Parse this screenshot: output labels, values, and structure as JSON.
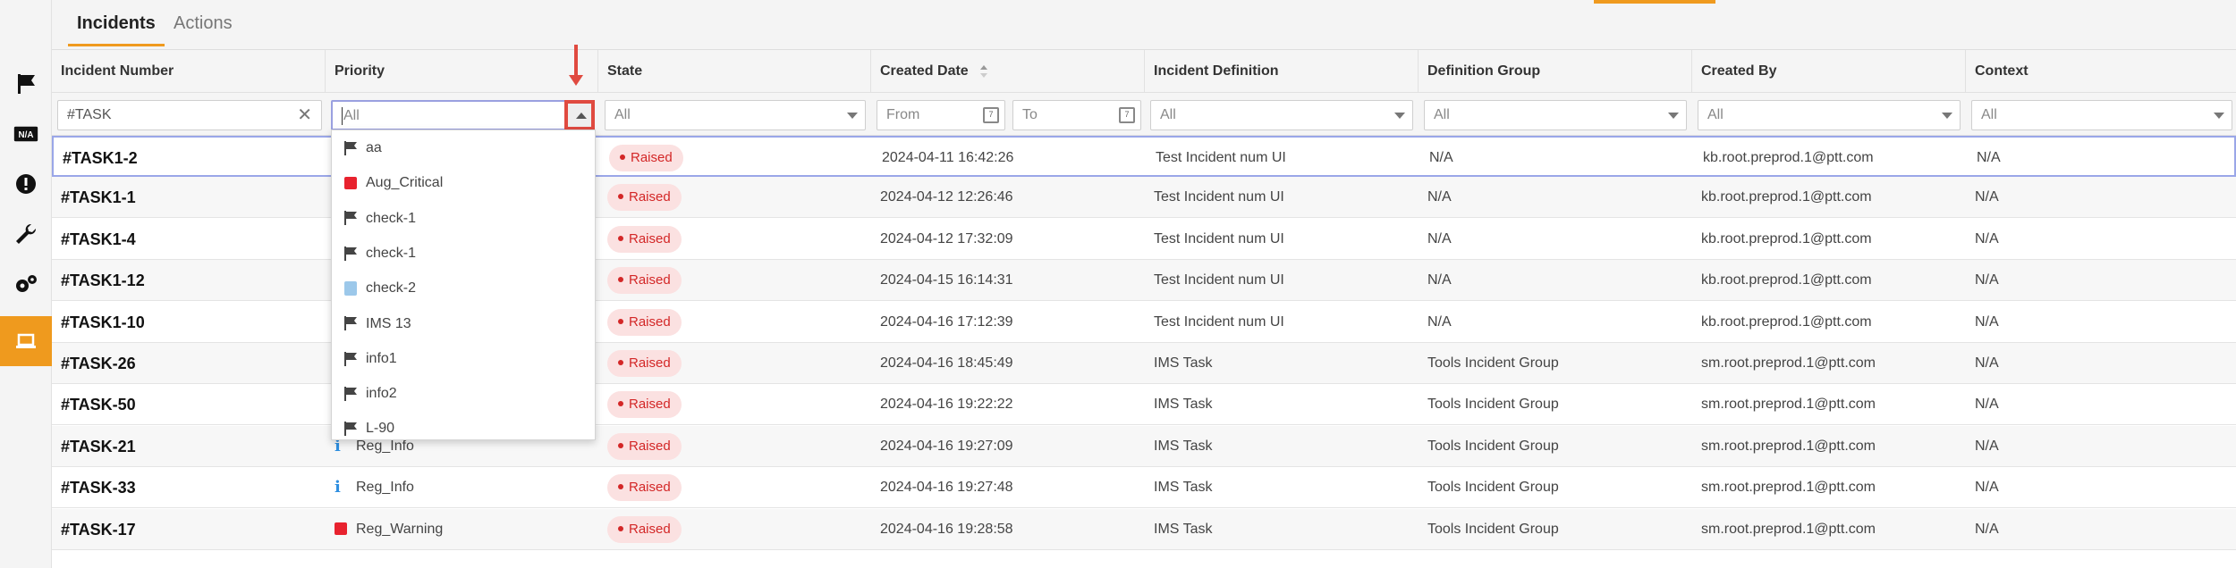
{
  "tabs": [
    "Incidents",
    "Actions"
  ],
  "sidebar": [
    "flag-icon",
    "na-icon",
    "alert-icon",
    "wrench-icon",
    "gears-icon",
    "laptop-icon"
  ],
  "sidebar_na_label": "N/A",
  "columns": [
    "Incident Number",
    "Priority",
    "State",
    "Created Date",
    "Incident Definition",
    "Definition Group",
    "Created By",
    "Context"
  ],
  "filters": {
    "incident_number": "#TASK",
    "priority": "All",
    "state": "All",
    "from": "From",
    "to": "To",
    "incident_definition": "All",
    "definition_group": "All",
    "created_by": "All",
    "context": "All"
  },
  "rows": [
    {
      "num": "#TASK1-2",
      "priority": "",
      "state": "Raised",
      "date": "2024-04-11 16:42:26",
      "definition": "Test Incident num UI",
      "group": "N/A",
      "by": "kb.root.preprod.1@ptt.com",
      "context": "N/A"
    },
    {
      "num": "#TASK1-1",
      "priority": "",
      "state": "Raised",
      "date": "2024-04-12 12:26:46",
      "definition": "Test Incident num UI",
      "group": "N/A",
      "by": "kb.root.preprod.1@ptt.com",
      "context": "N/A"
    },
    {
      "num": "#TASK1-4",
      "priority": "",
      "state": "Raised",
      "date": "2024-04-12 17:32:09",
      "definition": "Test Incident num UI",
      "group": "N/A",
      "by": "kb.root.preprod.1@ptt.com",
      "context": "N/A"
    },
    {
      "num": "#TASK1-12",
      "priority": "",
      "state": "Raised",
      "date": "2024-04-15 16:14:31",
      "definition": "Test Incident num UI",
      "group": "N/A",
      "by": "kb.root.preprod.1@ptt.com",
      "context": "N/A"
    },
    {
      "num": "#TASK1-10",
      "priority": "",
      "state": "Raised",
      "date": "2024-04-16 17:12:39",
      "definition": "Test Incident num UI",
      "group": "N/A",
      "by": "kb.root.preprod.1@ptt.com",
      "context": "N/A"
    },
    {
      "num": "#TASK-26",
      "priority": "",
      "state": "Raised",
      "date": "2024-04-16 18:45:49",
      "definition": "IMS Task",
      "group": "Tools Incident Group",
      "by": "sm.root.preprod.1@ptt.com",
      "context": "N/A"
    },
    {
      "num": "#TASK-50",
      "priority": "",
      "state": "Raised",
      "date": "2024-04-16 19:22:22",
      "definition": "IMS Task",
      "group": "Tools Incident Group",
      "by": "sm.root.preprod.1@ptt.com",
      "context": "N/A"
    },
    {
      "num": "#TASK-21",
      "priority": "Reg_Info",
      "priority_icon": "info-icon",
      "state": "Raised",
      "date": "2024-04-16 19:27:09",
      "definition": "IMS Task",
      "group": "Tools Incident Group",
      "by": "sm.root.preprod.1@ptt.com",
      "context": "N/A"
    },
    {
      "num": "#TASK-33",
      "priority": "Reg_Info",
      "priority_icon": "info-icon",
      "state": "Raised",
      "date": "2024-04-16 19:27:48",
      "definition": "IMS Task",
      "group": "Tools Incident Group",
      "by": "sm.root.preprod.1@ptt.com",
      "context": "N/A"
    },
    {
      "num": "#TASK-17",
      "priority": "Reg_Warning",
      "priority_icon": "red-square-icon",
      "state": "Raised",
      "date": "2024-04-16 19:28:58",
      "definition": "IMS Task",
      "group": "Tools Incident Group",
      "by": "sm.root.preprod.1@ptt.com",
      "context": "N/A"
    }
  ],
  "priority_options": [
    {
      "label": "aa",
      "icon": "flag-icon"
    },
    {
      "label": "Aug_Critical",
      "icon": "red-square-icon"
    },
    {
      "label": "check-1",
      "icon": "flag-icon"
    },
    {
      "label": "check-1",
      "icon": "flag-icon"
    },
    {
      "label": "check-2",
      "icon": "user-icon"
    },
    {
      "label": "IMS 13",
      "icon": "flag-icon"
    },
    {
      "label": "info1",
      "icon": "flag-icon"
    },
    {
      "label": "info2",
      "icon": "flag-icon"
    },
    {
      "label": "L-90",
      "icon": "flag-icon"
    }
  ],
  "colors": {
    "accent": "#ef9a1e",
    "raised_text": "#d32727",
    "raised_bg": "#fbe1e1",
    "highlight": "#e04a40"
  }
}
